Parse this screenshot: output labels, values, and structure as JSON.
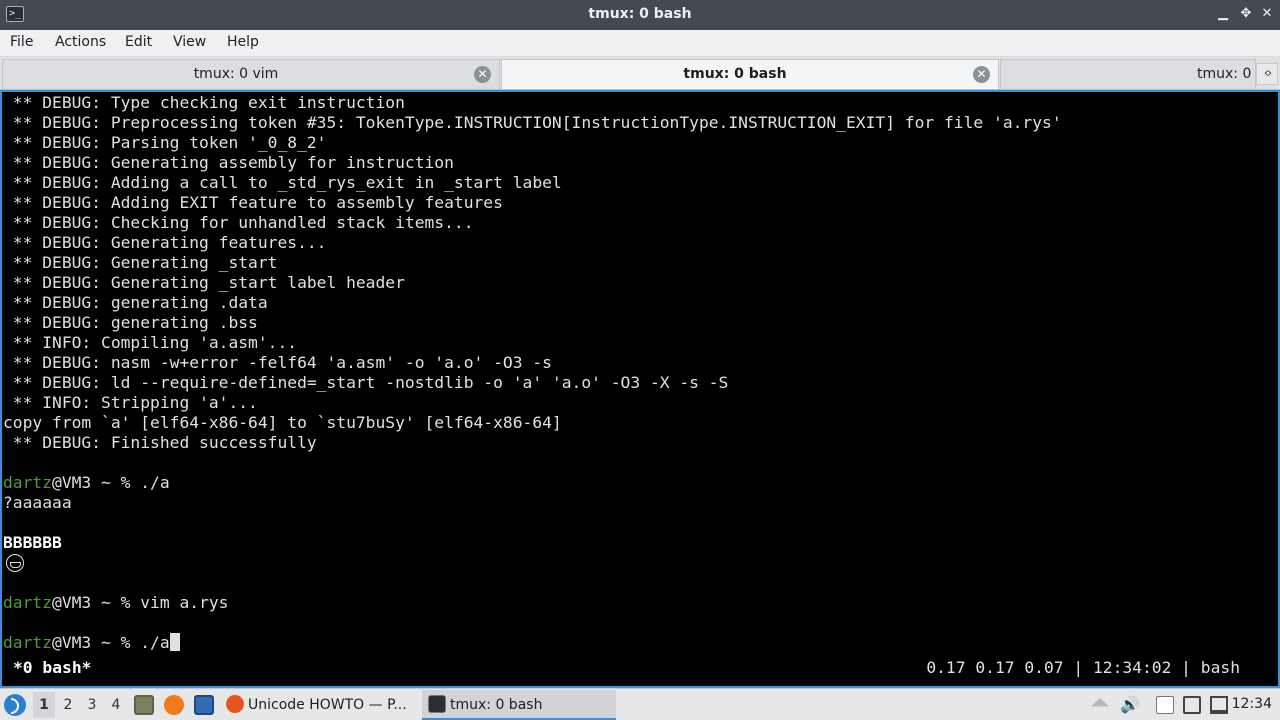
{
  "window": {
    "title": "tmux: 0 bash",
    "minimize_glyph": "▁",
    "maximize_glyph": "✥",
    "close_glyph": "✕"
  },
  "menu": [
    "File",
    "Actions",
    "Edit",
    "View",
    "Help"
  ],
  "tabs": [
    {
      "label": "tmux: 0 vim",
      "active": false
    },
    {
      "label": "tmux: 0 bash",
      "active": true
    },
    {
      "label": "tmux: 0",
      "active": false
    }
  ],
  "tab_scroll_glyph": "‹›",
  "terminal": {
    "lines": [
      " ** DEBUG: Type checking exit instruction",
      " ** DEBUG: Preprocessing token #35: TokenType.INSTRUCTION[InstructionType.INSTRUCTION_EXIT] for file 'a.rys'",
      " ** DEBUG: Parsing token '_0_8_2'",
      " ** DEBUG: Generating assembly for instruction",
      " ** DEBUG: Adding a call to _std_rys_exit in _start label",
      " ** DEBUG: Adding EXIT feature to assembly features",
      " ** DEBUG: Checking for unhandled stack items...",
      " ** DEBUG: Generating features...",
      " ** DEBUG: Generating _start",
      " ** DEBUG: Generating _start label header",
      " ** DEBUG: generating .data",
      " ** DEBUG: generating .bss",
      " ** INFO: Compiling 'a.asm'...",
      " ** DEBUG: nasm -w+error -felf64 'a.asm' -o 'a.o' -O3 -s",
      " ** DEBUG: ld --require-defined=_start -nostdlib -o 'a' 'a.o' -O3 -X -s -S",
      " ** INFO: Stripping 'a'...",
      "copy from `a' [elf64-x86-64] to `stu7buSy' [elf64-x86-64]",
      " ** DEBUG: Finished successfully",
      ""
    ],
    "prompt_user": "dartz",
    "prompt_rest": "@VM3 ~ % ",
    "cmd1": "./a",
    "out1": "?aaaaaa",
    "out2": "BBBBBB",
    "cmd2": "vim a.rys",
    "cmd3": "./a"
  },
  "tmux_status": {
    "window": "*0 bash*",
    "right": "0.17 0.17 0.07 | 12:34:02 | bash"
  },
  "taskbar": {
    "workspaces": [
      "1",
      "2",
      "3",
      "4"
    ],
    "tasks": [
      {
        "label": "Unicode HOWTO — P...",
        "icon": "firefox-icon",
        "active": false
      },
      {
        "label": "tmux: 0 bash",
        "icon": "terminal-icon",
        "active": true
      }
    ],
    "clock": "12:34",
    "accent": "#3b8ed8"
  }
}
